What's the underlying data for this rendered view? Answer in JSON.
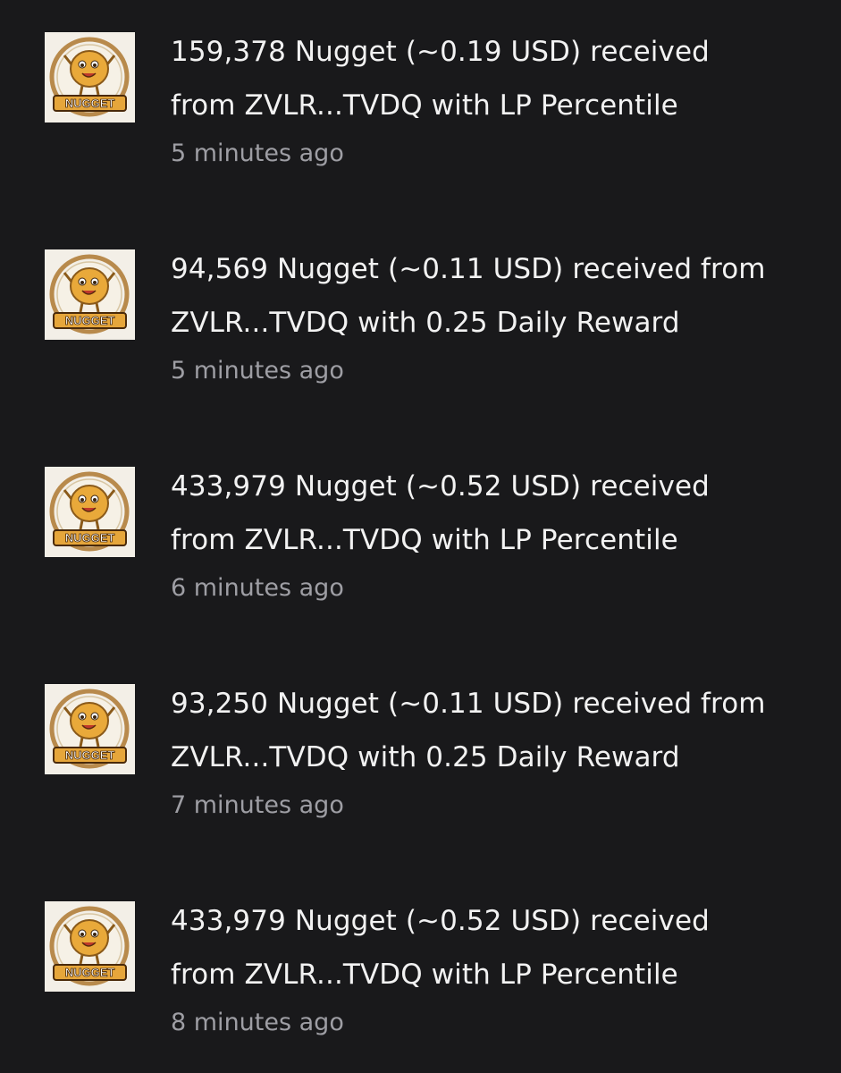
{
  "notifications": [
    {
      "line1": "159,378 Nugget (~0.19 USD) received",
      "line2": "from ZVLR...TVDQ with LP Percentile",
      "time": "5 minutes ago",
      "logo_text": "NUGGET",
      "icon": "nugget-token-icon"
    },
    {
      "line1": "94,569 Nugget (~0.11 USD) received from",
      "line2": "ZVLR...TVDQ with 0.25 Daily Reward",
      "time": "5 minutes ago",
      "logo_text": "NUGGET",
      "icon": "nugget-token-icon"
    },
    {
      "line1": "433,979 Nugget (~0.52 USD) received",
      "line2": "from ZVLR...TVDQ with LP Percentile",
      "time": "6 minutes ago",
      "logo_text": "NUGGET",
      "icon": "nugget-token-icon"
    },
    {
      "line1": "93,250 Nugget (~0.11 USD) received from",
      "line2": "ZVLR...TVDQ with 0.25 Daily Reward",
      "time": "7 minutes ago",
      "logo_text": "NUGGET",
      "icon": "nugget-token-icon"
    },
    {
      "line1": "433,979 Nugget (~0.52 USD) received",
      "line2": "from ZVLR...TVDQ with LP Percentile",
      "time": "8 minutes ago",
      "logo_text": "NUGGET",
      "icon": "nugget-token-icon"
    }
  ],
  "colors": {
    "background": "#19191b",
    "text": "#f2f2f2",
    "muted": "#9e9ea4",
    "logo_bg": "#f3efe7",
    "nugget": "#e9a93a",
    "ring": "#b88a4c"
  }
}
